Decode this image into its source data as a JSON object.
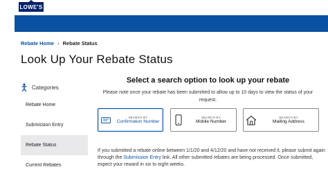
{
  "brand": {
    "logo_text": "LOWE'S",
    "primary_color": "#012169",
    "accent_color": "#0a51a1"
  },
  "breadcrumb": {
    "home": "Rebate Home",
    "separator": "›",
    "current": "Rebate Status"
  },
  "page_title": "Look Up Your Rebate Status",
  "sidebar": {
    "header": "Categories",
    "items": [
      {
        "label": "Rebate Home"
      },
      {
        "label": "Submission Entry"
      },
      {
        "label": "Rebate Status"
      },
      {
        "label": "Current Rebates"
      }
    ],
    "active_item": "Rebate Status"
  },
  "main": {
    "heading": "Select a search option to look up your rebate",
    "note": "Please note once your rebate has been submitted to allow up to 10 days to view the status of your request.",
    "search_options": [
      {
        "small": "SEARCH BY",
        "label": "Confirmation Number",
        "icon": "ticket-icon",
        "selected": true
      },
      {
        "small": "SEARCH BY",
        "label": "Mobile Number",
        "icon": "phone-icon",
        "selected": false
      },
      {
        "small": "SEARCH BY",
        "label": "Mailing Address",
        "icon": "house-icon",
        "selected": false
      }
    ],
    "info_part1": "If you submitted a rebate online between 1/1/20 and 4/12/20 and have not received it, please submit again through the ",
    "info_link": "Submission Entry",
    "info_part2": " link. All other submitted rebates are being processed. Once submitted, expect your reward in six to eight weeks."
  }
}
